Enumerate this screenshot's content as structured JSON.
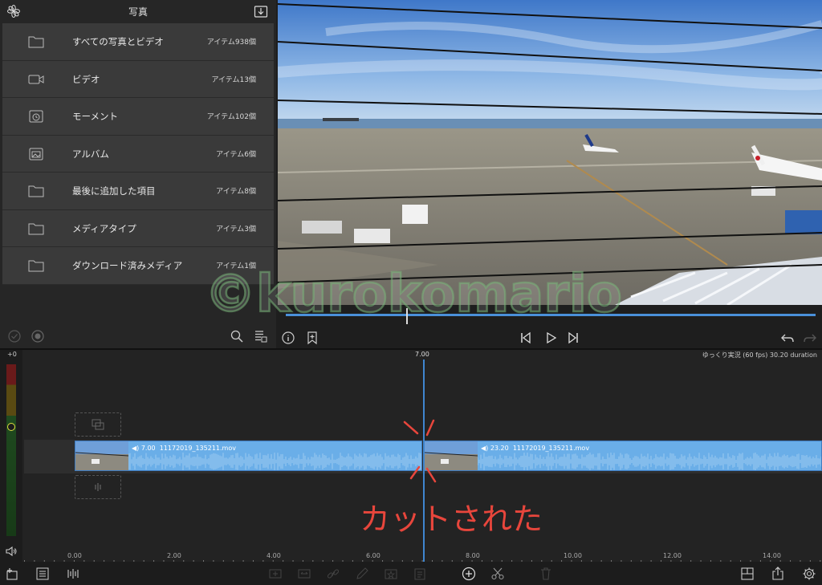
{
  "browser": {
    "title": "写真",
    "items": [
      {
        "label": "すべての写真とビデオ",
        "count": "アイテム938個",
        "icon": "folder-icon"
      },
      {
        "label": "ビデオ",
        "count": "アイテム13個",
        "icon": "video-camera-icon"
      },
      {
        "label": "モーメント",
        "count": "アイテム102個",
        "icon": "moments-icon"
      },
      {
        "label": "アルバム",
        "count": "アイテム6個",
        "icon": "album-icon"
      },
      {
        "label": "最後に追加した項目",
        "count": "アイテム8個",
        "icon": "folder-icon"
      },
      {
        "label": "メディアタイプ",
        "count": "アイテム3個",
        "icon": "folder-icon"
      },
      {
        "label": "ダウンロード済みメディア",
        "count": "アイテム1個",
        "icon": "folder-icon"
      }
    ]
  },
  "timeline": {
    "gain": "+0",
    "playhead_time": "7.00",
    "project_info": "ゆっくり実況 (60 fps)  30.20 duration",
    "clips": [
      {
        "duration": "7.00",
        "name": "11172019_135211.mov"
      },
      {
        "duration": "23.20",
        "name": "11172019_135211.mov"
      }
    ],
    "ruler": [
      "0.00",
      "2.00",
      "4.00",
      "6.00",
      "8.00",
      "10.00",
      "12.00",
      "14.00"
    ]
  },
  "annotation": {
    "text": "カットされた",
    "color": "#e8463c"
  },
  "watermark": {
    "text": "©kurokomario"
  },
  "colors": {
    "accent": "#4a90d9",
    "clip": "#6aaee8"
  }
}
